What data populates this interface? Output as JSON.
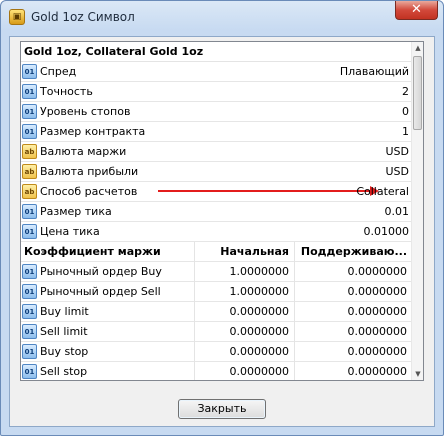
{
  "window": {
    "title": "Gold 1oz Символ",
    "close_glyph": "✕"
  },
  "grid": {
    "header": "Gold 1oz, Collateral Gold 1oz",
    "properties": [
      {
        "icon": "numeric-icon",
        "label": "Спред",
        "value": "Плавающий"
      },
      {
        "icon": "numeric-icon",
        "label": "Точность",
        "value": "2"
      },
      {
        "icon": "numeric-icon",
        "label": "Уровень стопов",
        "value": "0"
      },
      {
        "icon": "numeric-icon",
        "label": "Размер контракта",
        "value": "1"
      },
      {
        "icon": "text-icon",
        "label": "Валюта маржи",
        "value": "USD"
      },
      {
        "icon": "text-icon",
        "label": "Валюта прибыли",
        "value": "USD"
      },
      {
        "icon": "text-icon",
        "label": "Способ расчетов",
        "value": "Collateral"
      },
      {
        "icon": "numeric-icon",
        "label": "Размер тика",
        "value": "0.01"
      },
      {
        "icon": "numeric-icon",
        "label": "Цена тика",
        "value": "0.01000"
      }
    ],
    "margin_header": {
      "col1": "Коэффициент маржи",
      "col2": "Начальная",
      "col3": "Поддерживаю..."
    },
    "margin_rows": [
      {
        "label": "Рыночный ордер Buy",
        "initial": "1.0000000",
        "maintenance": "0.0000000"
      },
      {
        "label": "Рыночный ордер Sell",
        "initial": "1.0000000",
        "maintenance": "0.0000000"
      },
      {
        "label": "Buy limit",
        "initial": "0.0000000",
        "maintenance": "0.0000000"
      },
      {
        "label": "Sell limit",
        "initial": "0.0000000",
        "maintenance": "0.0000000"
      },
      {
        "label": "Buy stop",
        "initial": "0.0000000",
        "maintenance": "0.0000000"
      },
      {
        "label": "Sell stop",
        "initial": "0.0000000",
        "maintenance": "0.0000000"
      }
    ],
    "icon_glyph": {
      "numeric": "01",
      "text": "ab"
    }
  },
  "footer": {
    "close_label": "Закрыть"
  },
  "colors": {
    "accent_arrow": "#e31c1c",
    "titlebar": "#c7daf1"
  }
}
